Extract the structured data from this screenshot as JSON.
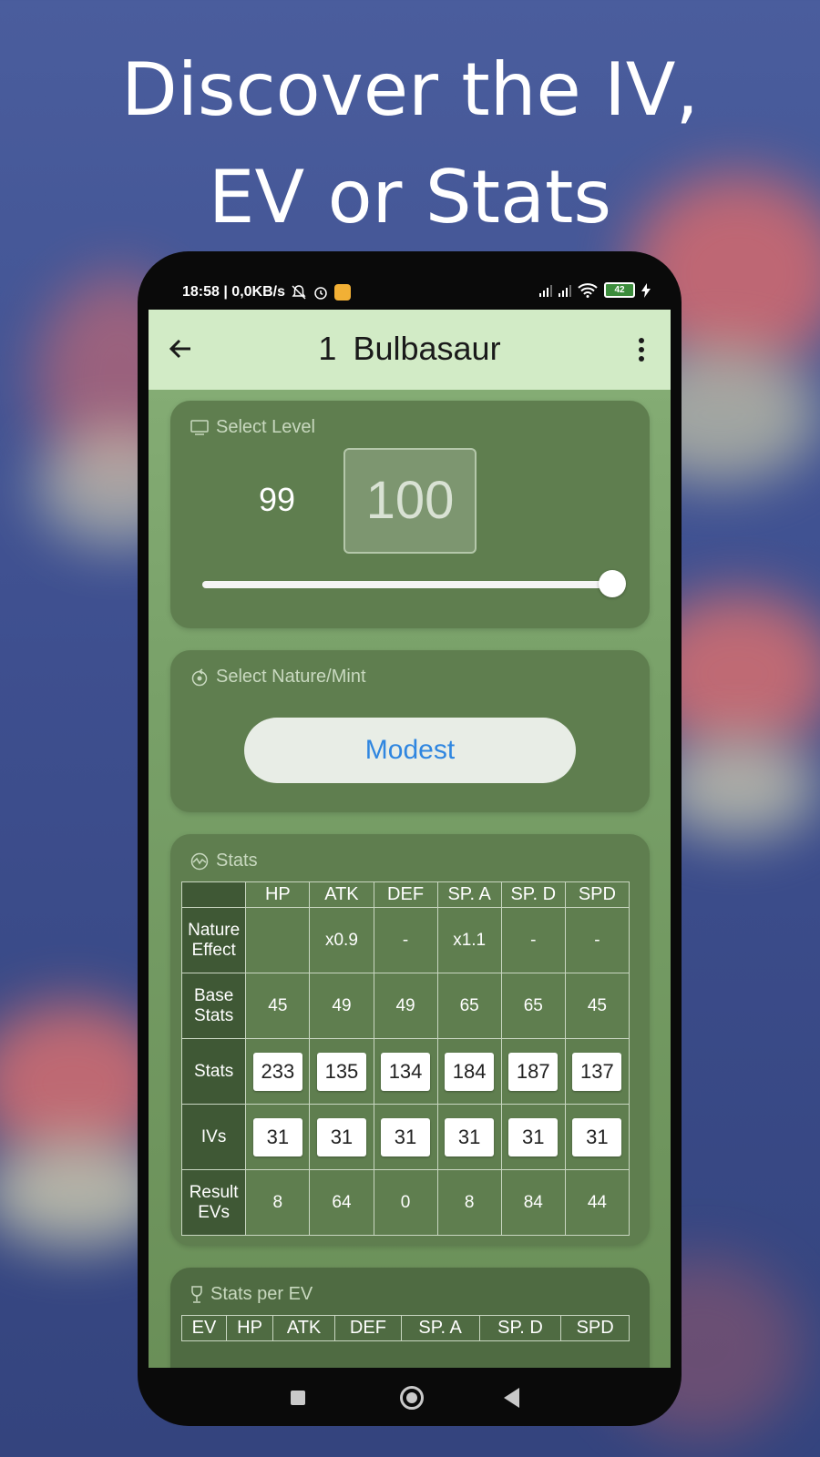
{
  "headline": {
    "line1": "Discover the IV,",
    "line2": "EV or Stats"
  },
  "status_bar": {
    "time_net": "18:58 | 0,0KB/s",
    "battery": "42"
  },
  "app_bar": {
    "number": "1",
    "name": "Bulbasaur"
  },
  "level_card": {
    "title": "Select Level",
    "previous_level": "99",
    "current_level": "100",
    "slider_fraction": 1.0
  },
  "nature_card": {
    "title": "Select Nature/Mint",
    "selected": "Modest"
  },
  "stats_card": {
    "title": "Stats",
    "columns": [
      "HP",
      "ATK",
      "DEF",
      "SP. A",
      "SP. D",
      "SPD"
    ],
    "rows": {
      "nature_effect": {
        "label_line1": "Nature",
        "label_line2": "Effect",
        "values": [
          "",
          "x0.9",
          "-",
          "x1.1",
          "-",
          "-"
        ]
      },
      "base_stats": {
        "label_line1": "Base",
        "label_line2": "Stats",
        "values": [
          "45",
          "49",
          "49",
          "65",
          "65",
          "45"
        ]
      },
      "stats": {
        "label": "Stats",
        "values": [
          "233",
          "135",
          "134",
          "184",
          "187",
          "137"
        ]
      },
      "ivs": {
        "label": "IVs",
        "values": [
          "31",
          "31",
          "31",
          "31",
          "31",
          "31"
        ]
      },
      "result_evs": {
        "label_line1": "Result",
        "label_line2": "EVs",
        "values": [
          "8",
          "64",
          "0",
          "8",
          "84",
          "44"
        ]
      }
    }
  },
  "stats_per_ev_card": {
    "title": "Stats per EV",
    "columns": [
      "EV",
      "HP",
      "ATK",
      "DEF",
      "SP. A",
      "SP. D",
      "SPD"
    ]
  },
  "colors": {
    "accent_blue": "#2f86e0",
    "app_bar": "#d2ebc6",
    "card": "#5f7e4f"
  }
}
